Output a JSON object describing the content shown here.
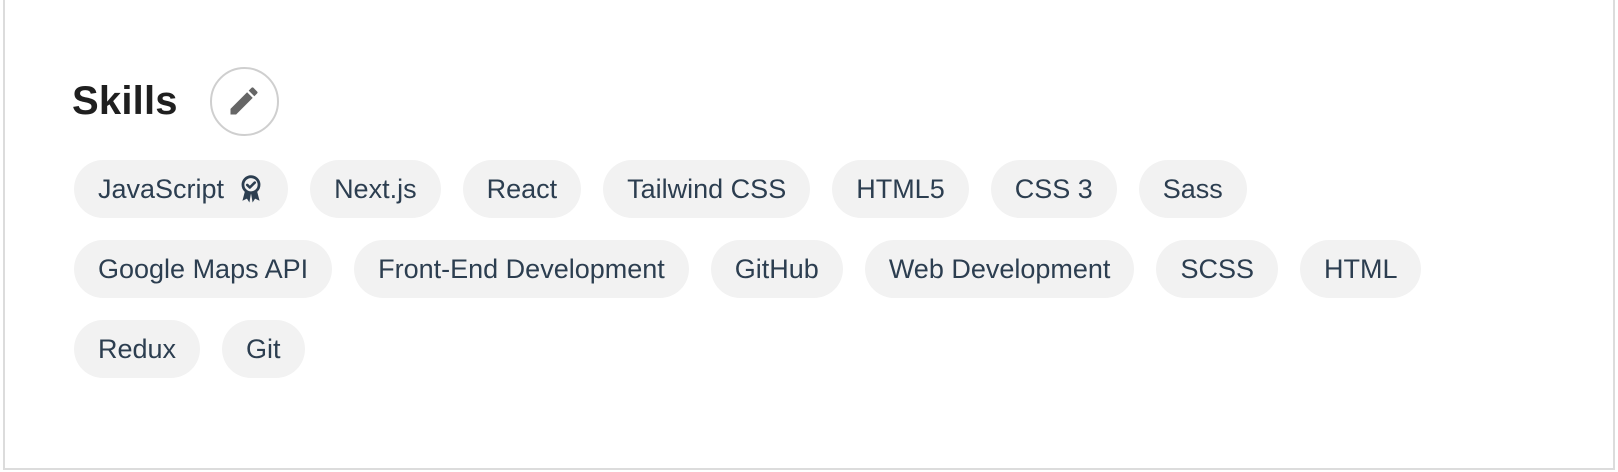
{
  "section": {
    "title": "Skills",
    "edit_icon": "pencil-icon"
  },
  "skills": [
    {
      "label": "JavaScript",
      "badge_icon": "award-ribbon-icon"
    },
    {
      "label": "Next.js"
    },
    {
      "label": "React"
    },
    {
      "label": "Tailwind CSS"
    },
    {
      "label": "HTML5"
    },
    {
      "label": "CSS 3"
    },
    {
      "label": "Sass"
    },
    {
      "label": "Google Maps API"
    },
    {
      "label": "Front-End Development"
    },
    {
      "label": "GitHub"
    },
    {
      "label": "Web Development"
    },
    {
      "label": "SCSS"
    },
    {
      "label": "HTML"
    },
    {
      "label": "Redux"
    },
    {
      "label": "Git"
    }
  ],
  "colors": {
    "pill_background": "#f2f2f2",
    "pill_text": "#2c3e50",
    "title_text": "#1f1f1f",
    "icon": "#666666"
  }
}
